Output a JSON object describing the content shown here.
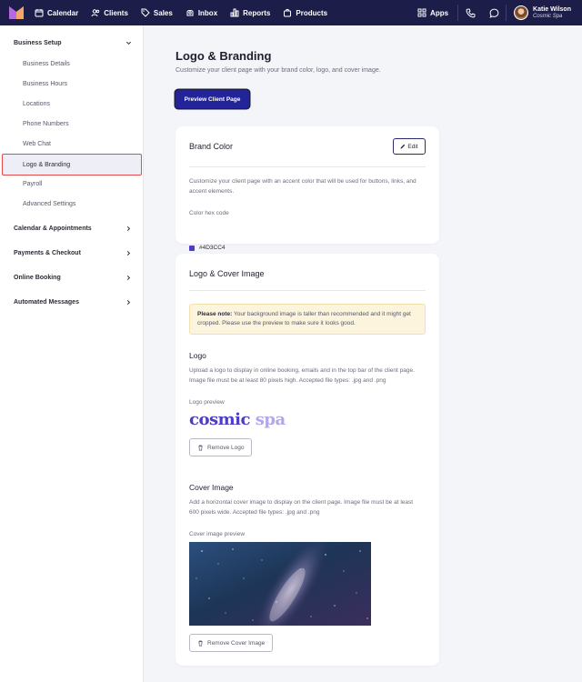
{
  "topnav": {
    "items": [
      {
        "label": "Calendar",
        "icon": "calendar-icon"
      },
      {
        "label": "Clients",
        "icon": "users-icon"
      },
      {
        "label": "Sales",
        "icon": "tag-icon"
      },
      {
        "label": "Inbox",
        "icon": "inbox-icon"
      },
      {
        "label": "Reports",
        "icon": "bar-chart-icon"
      },
      {
        "label": "Products",
        "icon": "bag-icon"
      }
    ],
    "apps_label": "Apps",
    "user": {
      "name": "Katie Wilson",
      "business": "Cosmic Spa"
    }
  },
  "sidebar": {
    "sections": [
      {
        "label": "Business Setup",
        "expanded": true
      },
      {
        "label": "Calendar & Appointments"
      },
      {
        "label": "Payments & Checkout"
      },
      {
        "label": "Online Booking"
      },
      {
        "label": "Automated Messages"
      }
    ],
    "business_setup_items": [
      "Business Details",
      "Business Hours",
      "Locations",
      "Phone Numbers",
      "Web Chat",
      "Logo & Branding",
      "Payroll",
      "Advanced Settings"
    ],
    "active_item": "Logo & Branding"
  },
  "main": {
    "title": "Logo & Branding",
    "subtitle": "Customize your client page with your brand color, logo, and cover image.",
    "preview_button": "Preview Client Page",
    "brand_color": {
      "title": "Brand Color",
      "edit_label": "Edit",
      "description": "Customize your client page with an accent color that will be used for buttons, links, and accent elements.",
      "hex_label": "Color hex code",
      "hex_value": "#4D3CC4",
      "accent_color": "#4D3CC4"
    },
    "logo_cover": {
      "title": "Logo & Cover Image",
      "notice_bold": "Please note:",
      "notice_text": " Your background image is taller than recommended and it might get cropped. Please use the preview to make sure it looks good.",
      "logo_title": "Logo",
      "logo_description": "Upload a logo to display in online booking, emails and in the top bar of the client page. Image file must be at least 80 pixels high. Accepted file types: .jpg and .png",
      "logo_preview_label": "Logo preview",
      "logo_word1": "cosmic",
      "logo_word2": "spa",
      "remove_logo": "Remove Logo",
      "cover_title": "Cover Image",
      "cover_description": "Add a horizontal cover image to display on the client page. Image file must be at least 600 pixels wide. Accepted file types: .jpg and .png",
      "cover_preview_label": "Cover image preview",
      "remove_cover": "Remove Cover Image"
    }
  }
}
